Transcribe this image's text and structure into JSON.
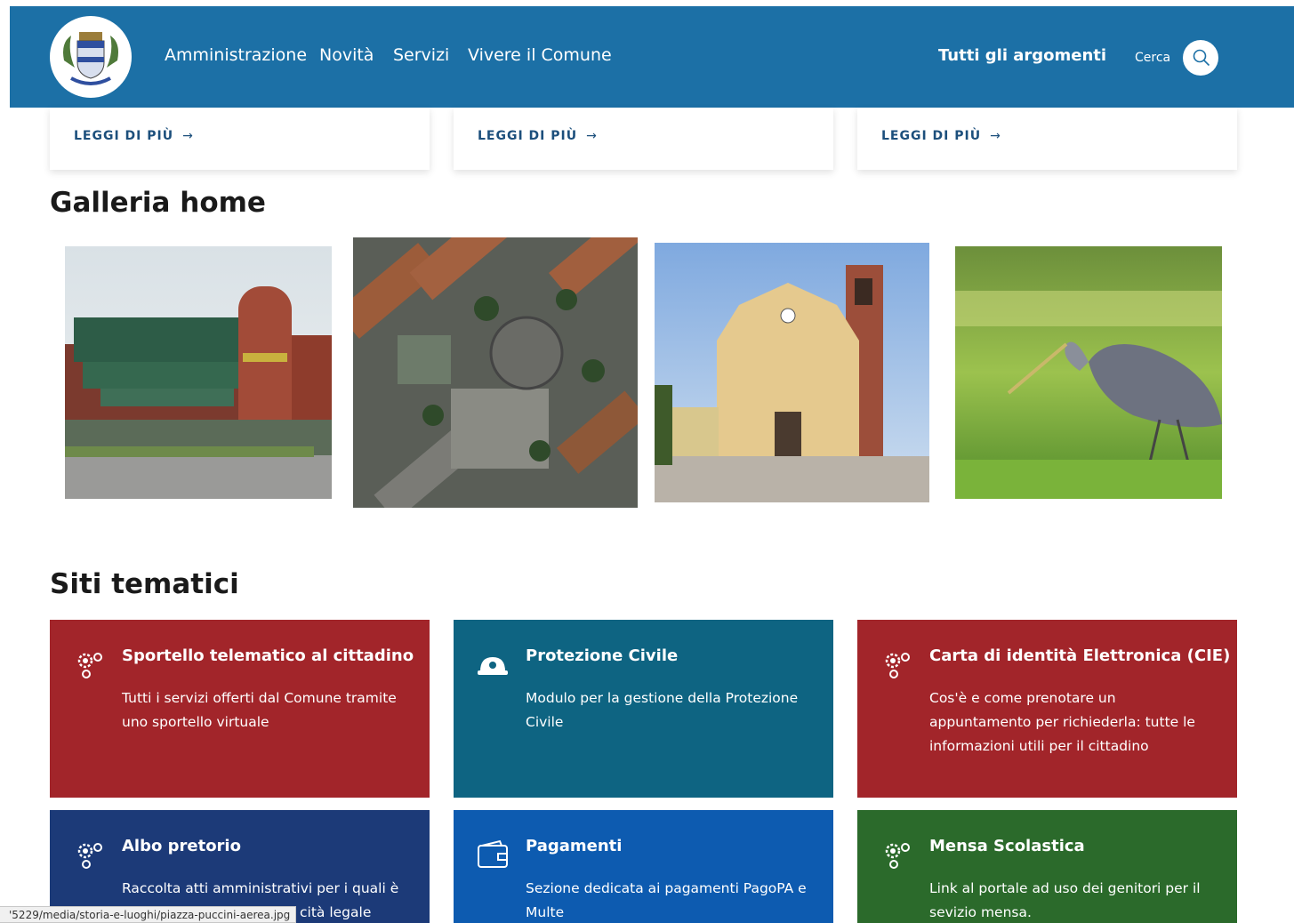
{
  "header": {
    "logo_icon": "municipal-coat-of-arms",
    "nav": [
      "Amministrazione",
      "Novità",
      "Servizi",
      "Vivere il Comune"
    ],
    "all_topics": "Tutti gli argomenti",
    "search_label": "Cerca",
    "search_icon": "search-icon",
    "color": "#1c70a6"
  },
  "cards": [
    {
      "more": "LEGGI DI PIÙ",
      "arrow": "→"
    },
    {
      "more": "LEGGI DI PIÙ",
      "arrow": "→"
    },
    {
      "more": "LEGGI DI PIÙ",
      "arrow": "→"
    }
  ],
  "gallery": {
    "title": "Galleria home",
    "images": [
      "municipal-building-photo",
      "aerial-square-photo",
      "church-photo",
      "heron-photo"
    ]
  },
  "themed_sites": {
    "title": "Siti tematici",
    "tiles": [
      {
        "icon": "gears-icon",
        "title": "Sportello telematico al cittadino",
        "desc": "Tutti i servizi offerti dal Comune tramite uno sportello virtuale",
        "color": "#a2252a"
      },
      {
        "icon": "helmet-icon",
        "title": "Protezione Civile",
        "desc": "Modulo per la gestione della Protezione Civile",
        "color": "#0e6482"
      },
      {
        "icon": "gears-icon",
        "title": "Carta di identità Elettronica (CIE)",
        "desc": "Cos'è e come prenotare un appuntamento per richiederla: tutte le informazioni utili per il cittadino",
        "color": "#a2252a"
      },
      {
        "icon": "gears-icon",
        "title": "Albo pretorio",
        "desc": "Raccolta atti amministrativi per i quali è",
        "desc2": "cità legale",
        "color": "#1c3a78"
      },
      {
        "icon": "wallet-icon",
        "title": "Pagamenti",
        "desc": "Sezione dedicata ai pagamenti PagoPA e Multe",
        "color": "#0d5bb0"
      },
      {
        "icon": "gears-icon",
        "title": "Mensa Scolastica",
        "desc": "Link al portale ad uso dei genitori per il sevizio mensa.",
        "color": "#2b6a2b"
      }
    ]
  },
  "status_bar": "'5229/media/storia-e-luoghi/piazza-puccini-aerea.jpg"
}
